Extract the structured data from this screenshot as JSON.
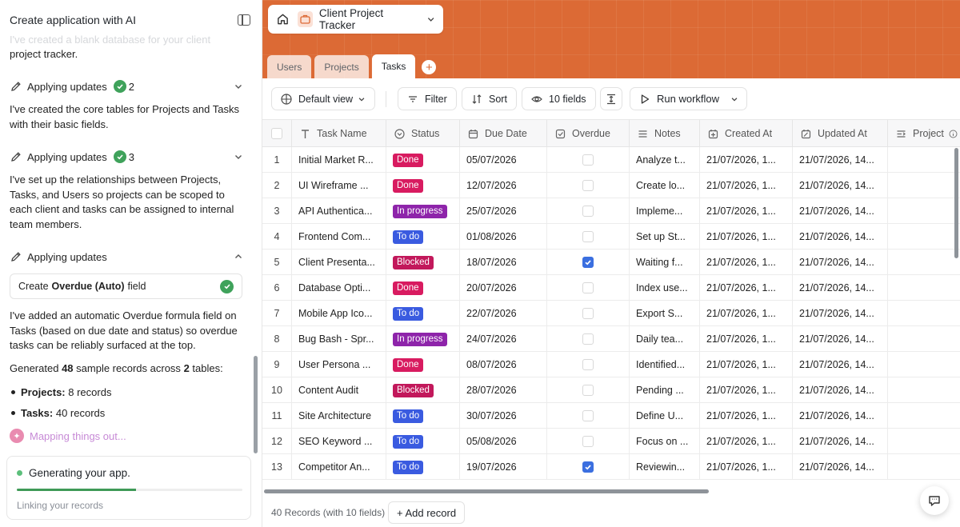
{
  "ai_panel": {
    "title": "Create application with AI",
    "faded_text": "I've created a blank database for your client",
    "intro_tail": "project tracker.",
    "updates": [
      {
        "label": "Applying updates",
        "count": "2",
        "text": "I've created the core tables for Projects and Tasks with their basic fields."
      },
      {
        "label": "Applying updates",
        "count": "3",
        "text": "I've set up the relationships between Projects, Tasks, and Users so projects can be scoped to each client and tasks can be assigned to internal team members."
      },
      {
        "label": "Applying updates"
      }
    ],
    "field_task": {
      "prefix": "Create",
      "name": "Overdue (Auto)",
      "suffix": "field"
    },
    "overdue_text": "I've added an automatic Overdue formula field on Tasks (based on due date and status) so overdue tasks can be reliably surfaced at the top.",
    "generated": {
      "prefix": "Generated",
      "count": "48",
      "middle": "sample records across",
      "tables": "2",
      "suffix": "tables:"
    },
    "bullets": [
      {
        "name": "Projects:",
        "value": "8 records"
      },
      {
        "name": "Tasks:",
        "value": "40 records"
      }
    ],
    "mapping": "Mapping things out...",
    "generating": {
      "title": "Generating your app.",
      "subtitle": "Linking your records",
      "progress": 0.53
    }
  },
  "app": {
    "name": "Client Project Tracker",
    "accent": "#dc6a35",
    "tabs": [
      "Users",
      "Projects",
      "Tasks"
    ],
    "active_tab": "Tasks",
    "toolbar": {
      "view": "Default view",
      "filter": "Filter",
      "sort": "Sort",
      "fields": "10 fields",
      "workflow": "Run workflow"
    },
    "columns": [
      "Task Name",
      "Status",
      "Due Date",
      "Overdue",
      "Notes",
      "Created At",
      "Updated At",
      "Project"
    ],
    "status_colors": {
      "Done": "#d81b60",
      "In progress": "#8e24aa",
      "To do": "#3a5be0",
      "Blocked": "#c2185b"
    },
    "rows": [
      {
        "n": "1",
        "task": "Initial Market R...",
        "status": "Done",
        "due": "05/07/2026",
        "overdue": false,
        "notes": "Analyze t...",
        "created": "21/07/2026, 1...",
        "updated": "21/07/2026, 14..."
      },
      {
        "n": "2",
        "task": "UI Wireframe ...",
        "status": "Done",
        "due": "12/07/2026",
        "overdue": false,
        "notes": "Create lo...",
        "created": "21/07/2026, 1...",
        "updated": "21/07/2026, 14..."
      },
      {
        "n": "3",
        "task": "API Authentica...",
        "status": "In progress",
        "due": "25/07/2026",
        "overdue": false,
        "notes": "Impleme...",
        "created": "21/07/2026, 1...",
        "updated": "21/07/2026, 14..."
      },
      {
        "n": "4",
        "task": "Frontend Com...",
        "status": "To do",
        "due": "01/08/2026",
        "overdue": false,
        "notes": "Set up St...",
        "created": "21/07/2026, 1...",
        "updated": "21/07/2026, 14..."
      },
      {
        "n": "5",
        "task": "Client Presenta...",
        "status": "Blocked",
        "due": "18/07/2026",
        "overdue": true,
        "notes": "Waiting f...",
        "created": "21/07/2026, 1...",
        "updated": "21/07/2026, 14..."
      },
      {
        "n": "6",
        "task": "Database Opti...",
        "status": "Done",
        "due": "20/07/2026",
        "overdue": false,
        "notes": "Index use...",
        "created": "21/07/2026, 1...",
        "updated": "21/07/2026, 14..."
      },
      {
        "n": "7",
        "task": "Mobile App Ico...",
        "status": "To do",
        "due": "22/07/2026",
        "overdue": false,
        "notes": "Export S...",
        "created": "21/07/2026, 1...",
        "updated": "21/07/2026, 14..."
      },
      {
        "n": "8",
        "task": "Bug Bash - Spr...",
        "status": "In progress",
        "due": "24/07/2026",
        "overdue": false,
        "notes": "Daily tea...",
        "created": "21/07/2026, 1...",
        "updated": "21/07/2026, 14..."
      },
      {
        "n": "9",
        "task": "User Persona ...",
        "status": "Done",
        "due": "08/07/2026",
        "overdue": false,
        "notes": "Identified...",
        "created": "21/07/2026, 1...",
        "updated": "21/07/2026, 14..."
      },
      {
        "n": "10",
        "task": "Content Audit",
        "status": "Blocked",
        "due": "28/07/2026",
        "overdue": false,
        "notes": "Pending ...",
        "created": "21/07/2026, 1...",
        "updated": "21/07/2026, 14..."
      },
      {
        "n": "11",
        "task": "Site Architecture",
        "status": "To do",
        "due": "30/07/2026",
        "overdue": false,
        "notes": "Define U...",
        "created": "21/07/2026, 1...",
        "updated": "21/07/2026, 14..."
      },
      {
        "n": "12",
        "task": "SEO Keyword ...",
        "status": "To do",
        "due": "05/08/2026",
        "overdue": false,
        "notes": "Focus on ...",
        "created": "21/07/2026, 1...",
        "updated": "21/07/2026, 14..."
      },
      {
        "n": "13",
        "task": "Competitor An...",
        "status": "To do",
        "due": "19/07/2026",
        "overdue": true,
        "notes": "Reviewin...",
        "created": "21/07/2026, 1...",
        "updated": "21/07/2026, 14..."
      }
    ],
    "footer": {
      "record_count": "40 Records (with 10 fields)",
      "add_record": "+ Add record"
    }
  }
}
